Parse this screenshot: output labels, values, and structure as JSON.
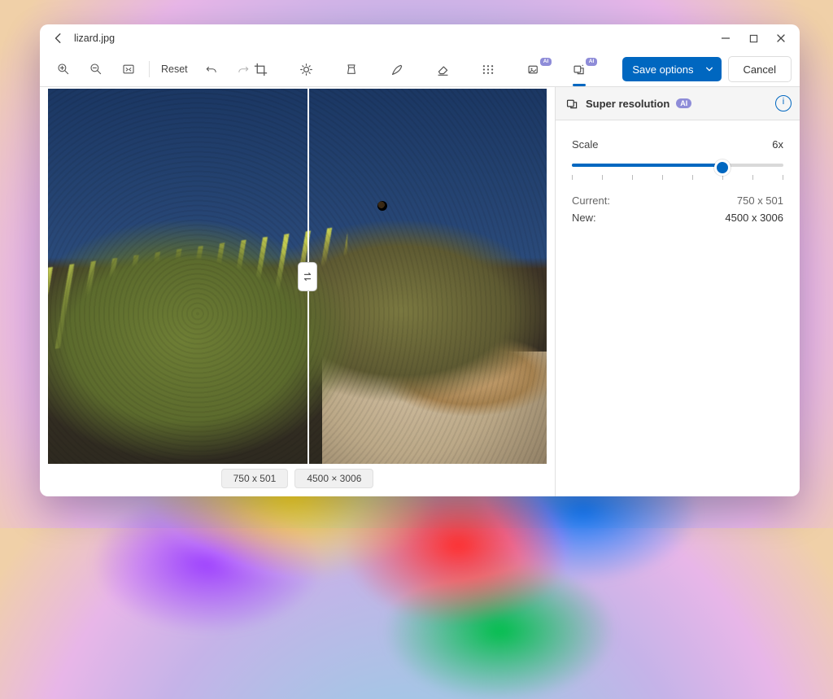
{
  "filename": "lizard.jpg",
  "toolbar": {
    "reset_label": "Reset",
    "save_label": "Save options",
    "cancel_label": "Cancel"
  },
  "panel": {
    "title": "Super resolution",
    "ai_label": "AI",
    "scale_label": "Scale",
    "scale_value": "6x",
    "slider_percent": 70,
    "current_label": "Current:",
    "current_value": "750 x 501",
    "new_label": "New:",
    "new_value": "4500 x 3006"
  },
  "compare": {
    "left_dim": "750 x 501",
    "right_dim": "4500 × 3006",
    "divider_percent": 52
  }
}
